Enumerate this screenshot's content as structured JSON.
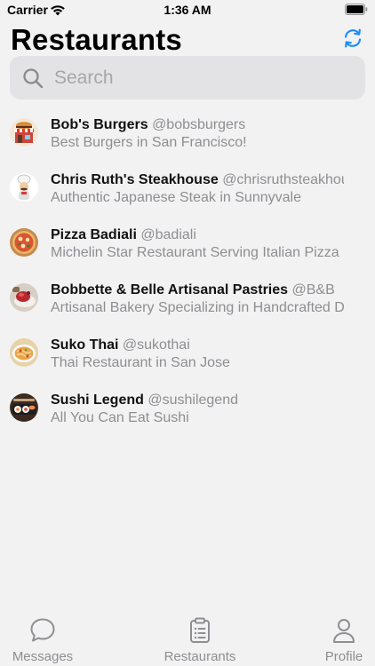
{
  "status_bar": {
    "carrier": "Carrier",
    "time": "1:36 AM"
  },
  "header": {
    "title": "Restaurants",
    "refresh_icon": "refresh-icon"
  },
  "search": {
    "placeholder": "Search",
    "value": ""
  },
  "restaurants": [
    {
      "name": "Bob's Burgers",
      "handle": "@bobsburgers",
      "description": "Best Burgers in San Francisco!",
      "avatar": "burger-shop"
    },
    {
      "name": "Chris Ruth's Steakhouse",
      "handle": "@chrisruthsteakhouse",
      "description": "Authentic Japanese Steak in Sunnyvale",
      "avatar": "chef"
    },
    {
      "name": "Pizza Badiali",
      "handle": "@badiali",
      "description": "Michelin Star Restaurant Serving Italian Pizza",
      "avatar": "pizza"
    },
    {
      "name": "Bobbette & Belle Artisanal Pastries",
      "handle": "@B&B",
      "description": "Artisanal Bakery Specializing in Handcrafted Desserts",
      "avatar": "pastry"
    },
    {
      "name": "Suko Thai",
      "handle": "@sukothai",
      "description": "Thai Restaurant in San Jose",
      "avatar": "noodles"
    },
    {
      "name": "Sushi Legend",
      "handle": "@sushilegend",
      "description": "All You Can Eat Sushi",
      "avatar": "sushi"
    }
  ],
  "tab_bar": {
    "tabs": [
      {
        "label": "Messages",
        "icon": "chat-bubble-icon"
      },
      {
        "label": "Restaurants",
        "icon": "clipboard-list-icon"
      },
      {
        "label": "Profile",
        "icon": "person-icon"
      }
    ]
  },
  "colors": {
    "background": "#f2f2f2",
    "accent": "#1a8cff",
    "secondary_text": "#8e8e93",
    "search_field": "#e3e3e5"
  }
}
